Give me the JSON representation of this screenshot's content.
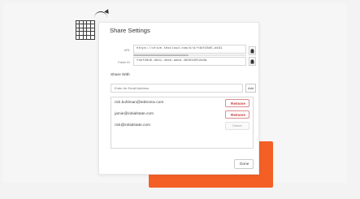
{
  "modal": {
    "title": "Share Settings",
    "url_label": "URL",
    "url_value": "https://drive.tekcloud.com/#/d/f4bf28d5-b641",
    "folder_id_label": "Folder ID",
    "folder_id_value": "f4bf28d5-b641-4eeb-adbd-495034552a3a",
    "share_with_label": "Share With",
    "email_placeholder": "Enter An Email Address",
    "add_label": "Add",
    "done_label": "Done"
  },
  "shared_users": [
    {
      "email": "rick.kuhlman@tektronix.com",
      "action": "Remove"
    },
    {
      "email": "jamie@initialstate.com",
      "action": "Remove"
    },
    {
      "email": "rick@initialstate.com",
      "action": "Owner"
    }
  ],
  "colors": {
    "accent": "#f45f26",
    "remove": "#c63b3b"
  },
  "icons": {
    "logo": "grid-logo-icon",
    "clipboard": "clipboard-icon"
  }
}
